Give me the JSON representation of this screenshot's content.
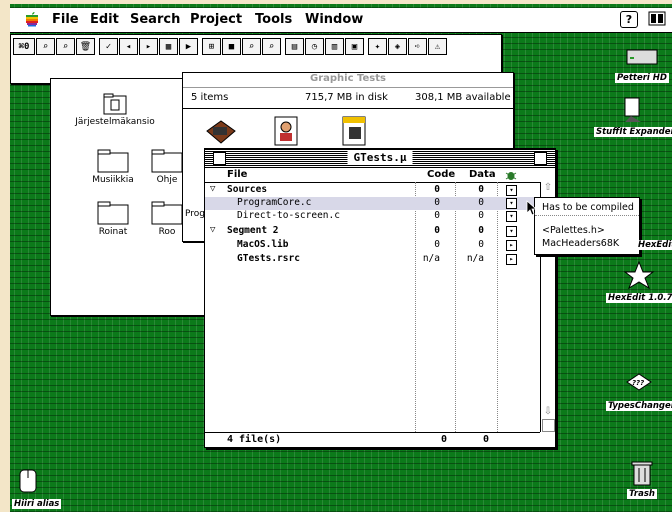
{
  "menubar": {
    "items": [
      "File",
      "Edit",
      "Search",
      "Project",
      "Tools",
      "Window"
    ]
  },
  "toolbar": {
    "first_button_label": "⌘0",
    "icons": [
      "find-icon",
      "find-icon",
      "trash-icon",
      "check-icon",
      "compile-icon",
      "make-icon",
      "disassemble-icon",
      "run-icon",
      "debug-icon",
      "search-file-icon",
      "search-file-icon",
      "browse-icon",
      "stopwatch-icon",
      "list-icon",
      "compare-icon",
      "print-icon",
      "back-icon",
      "forward-icon",
      "warning-icon"
    ]
  },
  "finder_back": {
    "items": [
      {
        "label": "Järjestelmäkansio"
      },
      {
        "label": "Musiikkia"
      },
      {
        "label": "Ohje"
      },
      {
        "label": "Roinat"
      },
      {
        "label": "Roo"
      }
    ]
  },
  "finder_mid": {
    "title": "Graphic Tests",
    "items_count": "5 items",
    "disk_used": "715,7 MB in disk",
    "available": "308,1 MB available",
    "partial_label": "Prog"
  },
  "project": {
    "title": "GTests.µ",
    "columns": {
      "file": "File",
      "code": "Code",
      "data": "Data"
    },
    "rows": [
      {
        "name": "Sources",
        "code": "0",
        "data": "0",
        "group": true
      },
      {
        "name": "ProgramCore.c",
        "code": "0",
        "data": "0",
        "group": false,
        "selected": true
      },
      {
        "name": "Direct-to-screen.c",
        "code": "0",
        "data": "0",
        "group": false
      },
      {
        "name": "Segment 2",
        "code": "0",
        "data": "0",
        "group": true
      },
      {
        "name": "MacOS.lib",
        "code": "0",
        "data": "0",
        "group": false,
        "bold": true
      },
      {
        "name": "GTests.rsrc",
        "code": "n/a",
        "data": "n/a",
        "group": false,
        "bold": true
      }
    ],
    "footer": {
      "files": "4 file(s)",
      "code": "0",
      "data": "0"
    }
  },
  "popup": {
    "items": [
      "Has to be compiled",
      "<Palettes.h>",
      "MacHeaders68K"
    ]
  },
  "desktop": {
    "icons": [
      {
        "label": "Petteri HD"
      },
      {
        "label": "StuffIt Expander"
      },
      {
        "label": "HexEdit"
      },
      {
        "label": "HexEdit 1.0.7"
      },
      {
        "label": "TypesChanger"
      },
      {
        "label": "Trash"
      },
      {
        "label": "Hiiri alias"
      }
    ]
  }
}
